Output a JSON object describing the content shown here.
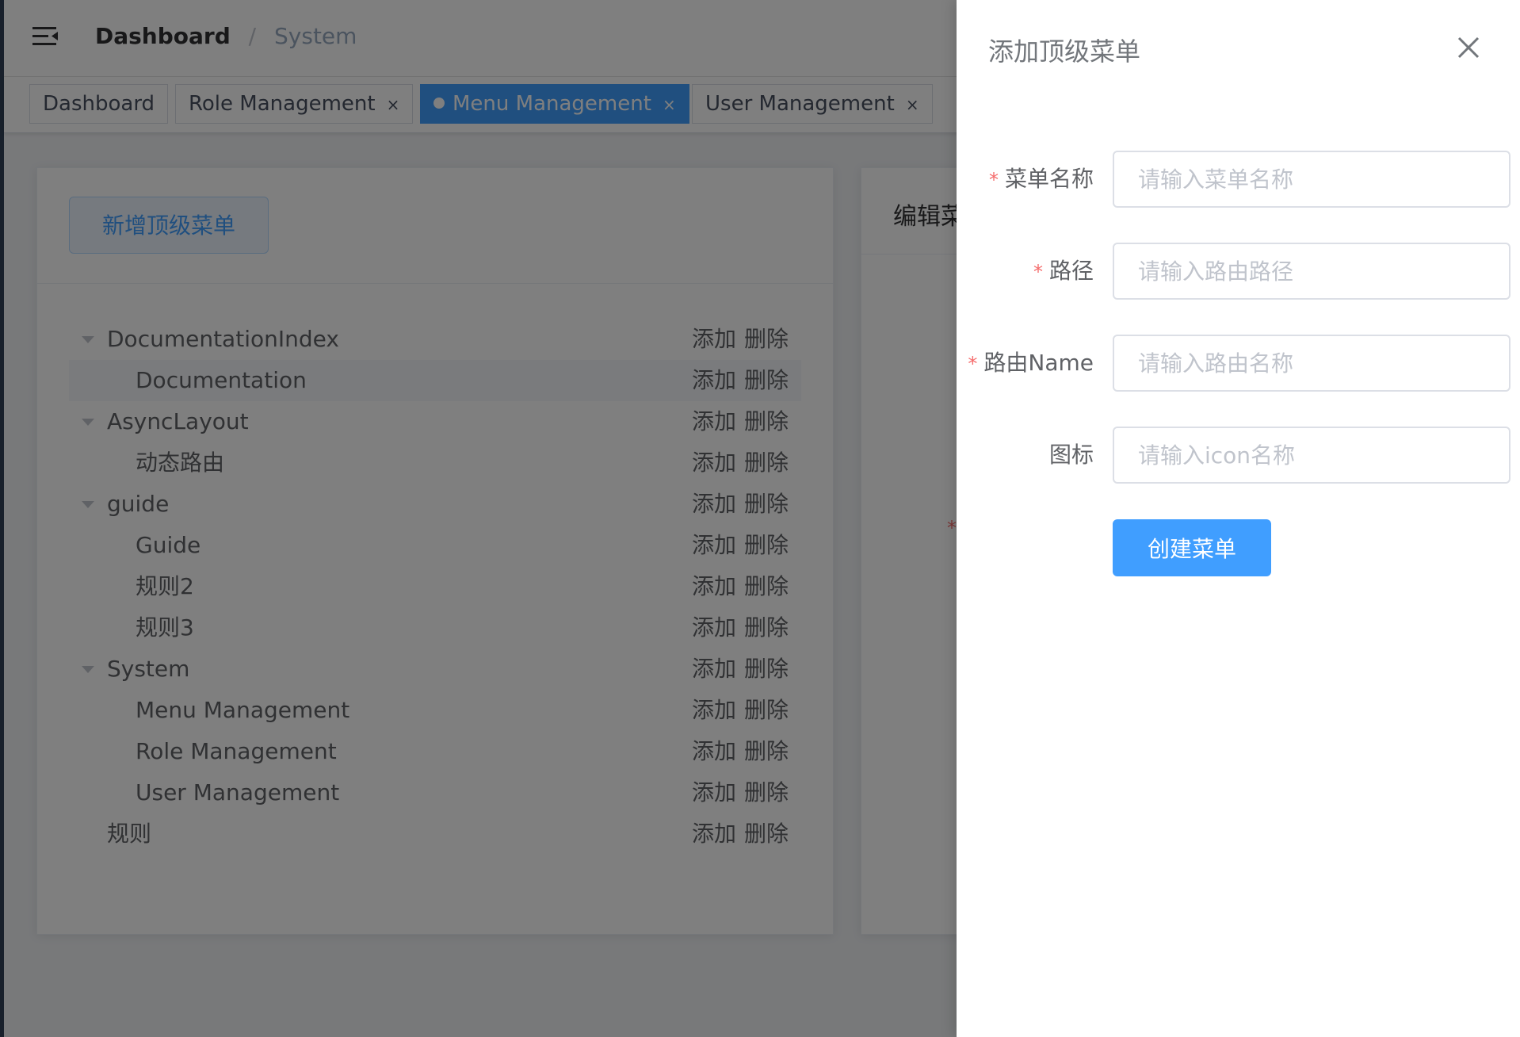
{
  "navbar": {
    "breadcrumb": {
      "home": "Dashboard",
      "separator": "/",
      "current": "System"
    }
  },
  "tags": [
    {
      "label": "Dashboard",
      "closable": false,
      "active": false
    },
    {
      "label": "Role Management",
      "closable": true,
      "active": false
    },
    {
      "label": "Menu Management",
      "closable": true,
      "active": true
    },
    {
      "label": "User Management",
      "closable": true,
      "active": false
    }
  ],
  "tag_close_glyph": "×",
  "left_panel": {
    "add_top_menu_button": "新增顶级菜单",
    "tree": [
      {
        "label": "DocumentationIndex",
        "level": 0,
        "expandable": true,
        "add": "添加",
        "delete": "删除"
      },
      {
        "label": "Documentation",
        "level": 1,
        "expandable": false,
        "add": "添加",
        "delete": "删除",
        "highlighted": true
      },
      {
        "label": "AsyncLayout",
        "level": 0,
        "expandable": true,
        "add": "添加",
        "delete": "删除"
      },
      {
        "label": "动态路由",
        "level": 1,
        "expandable": false,
        "add": "添加",
        "delete": "删除"
      },
      {
        "label": "guide",
        "level": 0,
        "expandable": true,
        "add": "添加",
        "delete": "删除"
      },
      {
        "label": "Guide",
        "level": 1,
        "expandable": false,
        "add": "添加",
        "delete": "删除"
      },
      {
        "label": "规则2",
        "level": 1,
        "expandable": false,
        "add": "添加",
        "delete": "删除"
      },
      {
        "label": "规则3",
        "level": 1,
        "expandable": false,
        "add": "添加",
        "delete": "删除"
      },
      {
        "label": "System",
        "level": 0,
        "expandable": true,
        "add": "添加",
        "delete": "删除"
      },
      {
        "label": "Menu Management",
        "level": 1,
        "expandable": false,
        "add": "添加",
        "delete": "删除"
      },
      {
        "label": "Role Management",
        "level": 1,
        "expandable": false,
        "add": "添加",
        "delete": "删除"
      },
      {
        "label": "User Management",
        "level": 1,
        "expandable": false,
        "add": "添加",
        "delete": "删除"
      },
      {
        "label": "规则",
        "level": 0,
        "expandable": false,
        "add": "添加",
        "delete": "删除"
      }
    ]
  },
  "right_panel": {
    "title": "编辑菜",
    "asterisk": "*"
  },
  "drawer": {
    "title": "添加顶级菜单",
    "fields": [
      {
        "label": "菜单名称",
        "required": true,
        "placeholder": "请输入菜单名称",
        "value": ""
      },
      {
        "label": "路径",
        "required": true,
        "placeholder": "请输入路由路径",
        "value": ""
      },
      {
        "label": "路由Name",
        "required": true,
        "placeholder": "请输入路由名称",
        "value": ""
      },
      {
        "label": "图标",
        "required": false,
        "placeholder": "请输入icon名称",
        "value": ""
      }
    ],
    "required_mark": "*",
    "submit_button": "创建菜单"
  },
  "colors": {
    "primary": "#409eff",
    "sidebar": "#304156",
    "required": "#f56c6c",
    "mask": "rgba(0,0,0,0.5)"
  },
  "icons": {
    "hamburger": "hamburger-icon",
    "close": "close-icon",
    "caret": "caret-down-icon"
  }
}
